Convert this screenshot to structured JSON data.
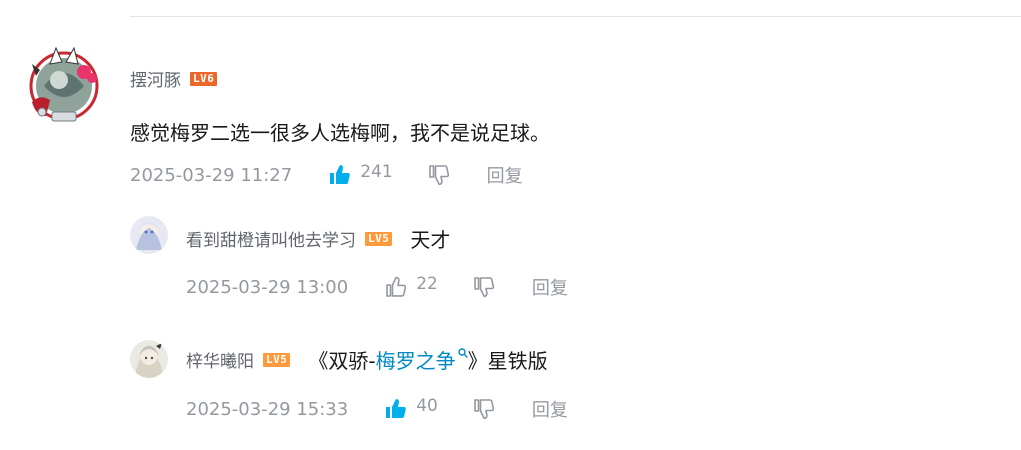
{
  "main_comment": {
    "username": "摆河豚",
    "level": "LV6",
    "level_color": "#ee672a",
    "text": "感觉梅罗二选一很多人选梅啊，我不是说足球。",
    "time": "2025-03-29 11:27",
    "likes": "241",
    "liked": true,
    "reply_label": "回复"
  },
  "replies": [
    {
      "username": "看到甜橙请叫他去学习",
      "level": "LV5",
      "level_color": "#ff9a3c",
      "text": "天才",
      "time": "2025-03-29 13:00",
      "likes": "22",
      "liked": false,
      "reply_label": "回复"
    },
    {
      "username": "梓华曦阳",
      "level": "LV5",
      "level_color": "#ff9a3c",
      "text_before": "《双骄-",
      "link_text": "梅罗之争",
      "text_after": "》星铁版",
      "time": "2025-03-29 15:33",
      "likes": "40",
      "liked": true,
      "reply_label": "回复"
    }
  ],
  "icons": {
    "like": "thumbs-up-icon",
    "dislike": "thumbs-down-icon",
    "search": "search-icon"
  },
  "colors": {
    "like_active": "#00aeec",
    "meta_gray": "#9499a0",
    "link_blue": "#008ac5"
  }
}
